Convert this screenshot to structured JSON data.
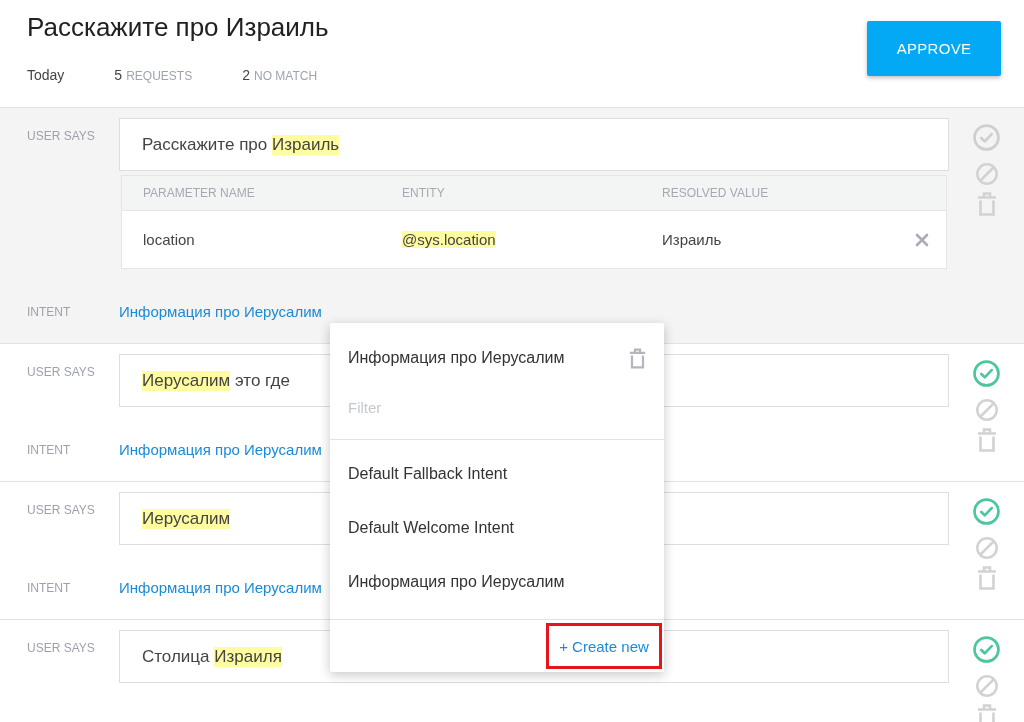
{
  "header": {
    "title": "Расскажите про Израиль",
    "stats": [
      {
        "kind": "date",
        "text": "Today"
      },
      {
        "kind": "count",
        "count": "5",
        "label": "REQUESTS"
      },
      {
        "kind": "count",
        "count": "2",
        "label": "NO MATCH"
      }
    ],
    "approve_button": "APPROVE"
  },
  "entries": [
    {
      "selected": true,
      "approved": false,
      "says_label": "USER SAYS",
      "segments": [
        {
          "text": "Расскажите про ",
          "highlighted": false
        },
        {
          "text": "Израиль",
          "highlighted": true
        }
      ],
      "parameters": {
        "columns": [
          "PARAMETER NAME",
          "ENTITY",
          "RESOLVED VALUE"
        ],
        "rows": [
          {
            "name": "location",
            "entity": "@sys.location",
            "value": "Израиль"
          }
        ]
      },
      "intent_label": "INTENT",
      "intent": "Информация про Иерусалим"
    },
    {
      "selected": false,
      "approved": true,
      "says_label": "USER SAYS",
      "segments": [
        {
          "text": "Иерусалим",
          "highlighted": true
        },
        {
          "text": " это где",
          "highlighted": false
        }
      ],
      "intent_label": "INTENT",
      "intent": "Информация про Иерусалим"
    },
    {
      "selected": false,
      "approved": true,
      "says_label": "USER SAYS",
      "segments": [
        {
          "text": "Иерусалим",
          "highlighted": true
        }
      ],
      "intent_label": "INTENT",
      "intent": "Информация про Иерусалим"
    },
    {
      "selected": false,
      "approved": true,
      "says_label": "USER SAYS",
      "segments": [
        {
          "text": "Столица ",
          "highlighted": false
        },
        {
          "text": "Израиля",
          "highlighted": true
        }
      ]
    }
  ],
  "intent_menu": {
    "current": "Информация про Иерусалим",
    "filter": {
      "placeholder": "Filter"
    },
    "options": [
      "Default Fallback Intent",
      "Default Welcome Intent",
      "Информация про Иерусалим"
    ],
    "create_new": {
      "label": "+ Create new",
      "highlighted": true
    }
  }
}
